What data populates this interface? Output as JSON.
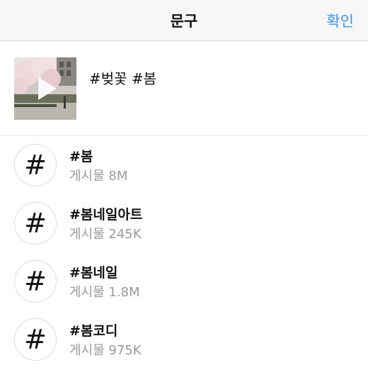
{
  "header": {
    "title": "문구",
    "confirm_label": "확인"
  },
  "composer": {
    "caption": "#벚꽃 #봄",
    "thumbnail_icon": "play-icon"
  },
  "suggestions": [
    {
      "tag": "#봄",
      "count": "게시물 8M"
    },
    {
      "tag": "#봄네일아트",
      "count": "게시물 245K"
    },
    {
      "tag": "#봄네일",
      "count": "게시물 1.8M"
    },
    {
      "tag": "#봄코디",
      "count": "게시물 975K"
    }
  ],
  "colors": {
    "accent": "#3897f0",
    "muted_text": "#999999",
    "header_bg": "#f7f7f7"
  }
}
